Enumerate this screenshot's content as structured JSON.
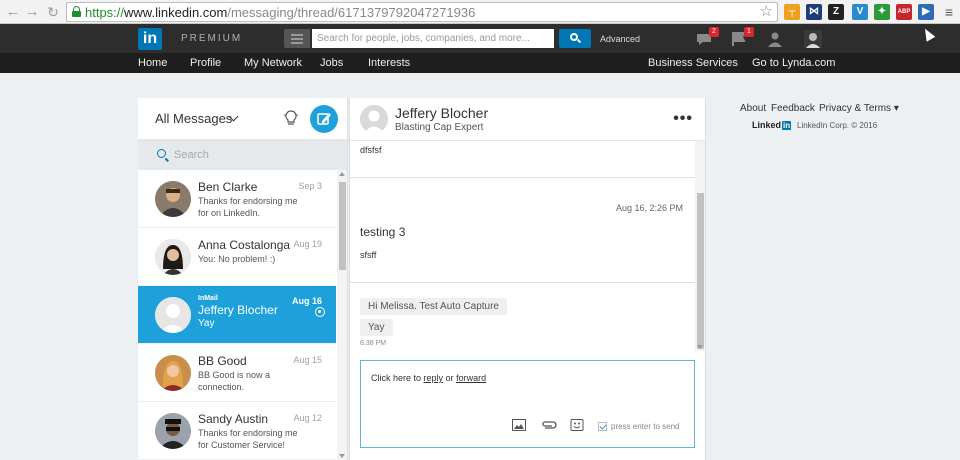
{
  "browser": {
    "url_scheme": "https://",
    "url_host": "www.linkedin.com",
    "url_path": "/messaging/thread/6171379792047271936",
    "extensions": [
      {
        "icon": "bookmark-icon",
        "color": "#f0a020",
        "text": "┬"
      },
      {
        "icon": "extension-x-icon",
        "color": "#1c3d7a",
        "text": "⋈"
      },
      {
        "icon": "extension-z-icon",
        "color": "#222222",
        "text": "Z"
      },
      {
        "icon": "extension-v-icon",
        "color": "#2a8ad0",
        "text": "V"
      },
      {
        "icon": "evernote-icon",
        "color": "#2d9a3a",
        "text": "✦"
      },
      {
        "icon": "adblock-icon",
        "color": "#c6262e",
        "text": "ABP"
      },
      {
        "icon": "extension-arrow-icon",
        "color": "#2e6db5",
        "text": "▶"
      }
    ],
    "menu_icon": "menu-icon"
  },
  "header": {
    "logo": "in",
    "premium": "PREMIUM",
    "search_placeholder": "Search for people, jobs, companies, and more...",
    "advanced": "Advanced",
    "messages_badge": "2",
    "notifications_badge": "1"
  },
  "nav": {
    "items": [
      "Home",
      "Profile",
      "My Network",
      "Jobs",
      "Interests"
    ],
    "right_items": [
      "Business Services",
      "Go to Lynda.com"
    ]
  },
  "inbox": {
    "title": "All Messages",
    "search_placeholder": "Search",
    "conversations": [
      {
        "name": "Ben Clarke",
        "snippet": "Thanks for endorsing me for on LinkedIn.",
        "date": "Sep 3"
      },
      {
        "name": "Anna Costalonga",
        "snippet": "You: No problem! :)",
        "date": "Aug 19"
      },
      {
        "name": "Jeffery Blocher",
        "snippet": "Yay",
        "date": "Aug 16",
        "tag": "InMail"
      },
      {
        "name": "BB Good",
        "snippet": "BB Good is now a connection.",
        "date": "Aug 15"
      },
      {
        "name": "Sandy Austin",
        "snippet": "Thanks for endorsing me for Customer Service!",
        "date": "Aug 12"
      }
    ]
  },
  "thread": {
    "name": "Jeffery Blocher",
    "title": "Blasting Cap Expert",
    "more": "•••",
    "messages": {
      "first_body": "dfsfsf",
      "time": "Aug 16, 2:26 PM",
      "subject": "testing 3",
      "body": "sfsff",
      "bubble1": "Hi Melissa. Test Auto Capture",
      "bubble2": "Yay",
      "bubble_time": "6:38 PM"
    },
    "reply": {
      "prefix": "Click here to",
      "reply_link": "reply",
      "or": "or",
      "forward_link": "forward",
      "send_label": "press enter to send"
    }
  },
  "right_column": {
    "links": [
      "About",
      "Feedback",
      "Privacy & Terms ▾"
    ],
    "brand": "Linked",
    "brand_in": "in",
    "copyright": "LinkedIn Corp. © 2016"
  }
}
